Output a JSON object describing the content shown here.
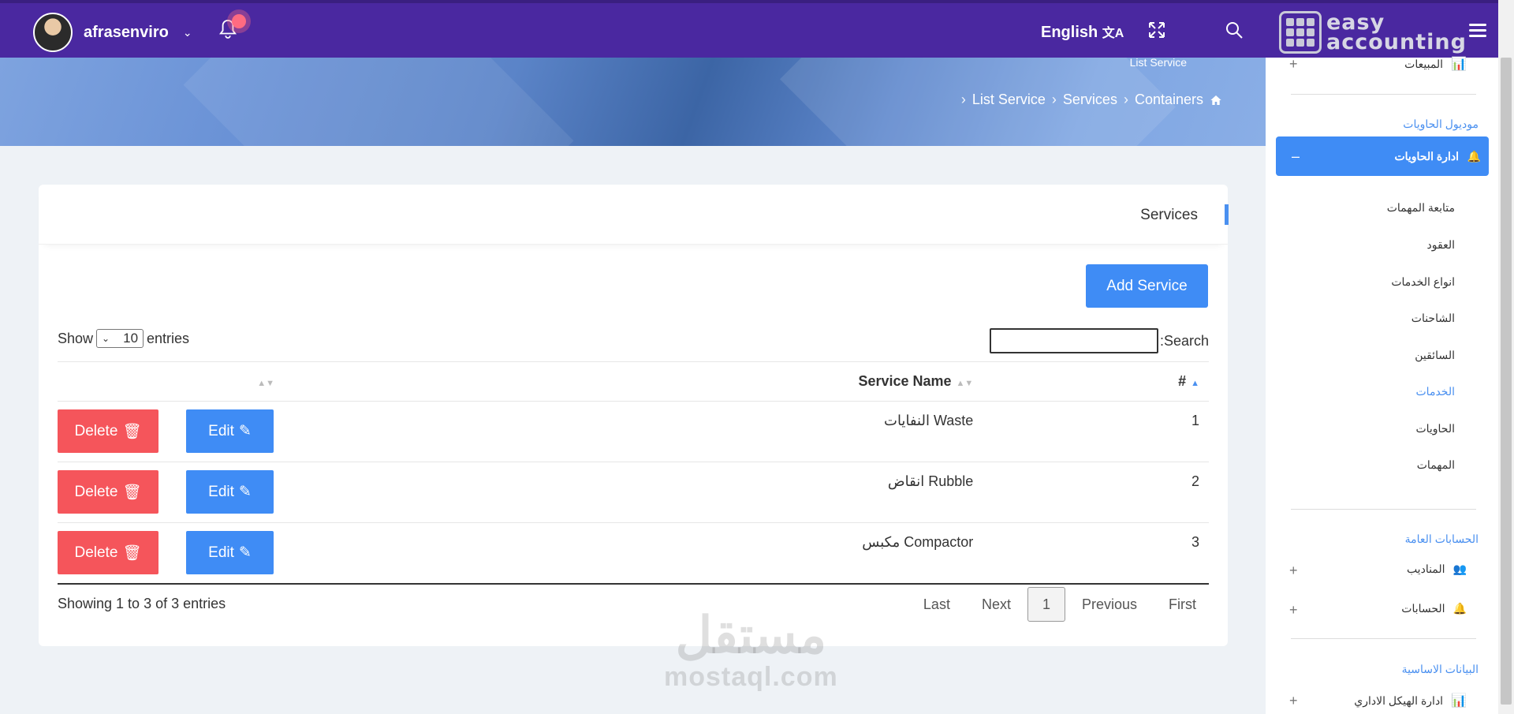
{
  "topbar": {
    "username": "afrasenviro",
    "language": "English",
    "logo_line1": "easy",
    "logo_line2": "accounting"
  },
  "banner": {
    "title": "List Service",
    "breadcrumb": [
      "List Service",
      "Services",
      "Containers"
    ]
  },
  "card": {
    "title": "Services",
    "add_button": "Add Service",
    "show_label": "Show",
    "entries_value": "10",
    "entries_label": "entries",
    "search_label": ":Search",
    "columns": {
      "num": "#",
      "name": "Service Name",
      "actions": ""
    },
    "rows": [
      {
        "num": "1",
        "name": "النفايات Waste",
        "edit": "Edit",
        "delete": "Delete"
      },
      {
        "num": "2",
        "name": "انقاض Rubble",
        "edit": "Edit",
        "delete": "Delete"
      },
      {
        "num": "3",
        "name": "مكبس Compactor",
        "edit": "Edit",
        "delete": "Delete"
      }
    ],
    "info": "Showing 1 to 3 of 3 entries",
    "pager": {
      "last": "Last",
      "next": "Next",
      "current": "1",
      "previous": "Previous",
      "first": "First"
    }
  },
  "watermark": {
    "arabic": "مستقل",
    "latin": "mostaql.com"
  },
  "sidebar": {
    "top_item": "المبيعات",
    "section_containers": "موديول الحاويات",
    "active_item": "ادارة الحاويات",
    "sub_items": [
      "متابعة المهمات",
      "العقود",
      "انواع الخدمات",
      "الشاحنات",
      "السائقين",
      "الخدمات",
      "الحاويات",
      "المهمات"
    ],
    "current_sub": "الخدمات",
    "section_accounts": "الحسابات العامة",
    "accounts_items": [
      "المناديب",
      "الحسابات"
    ],
    "section_basic": "البيانات الاساسية",
    "basic_items": [
      "ادارة الهيكل الاداري"
    ]
  },
  "colors": {
    "topbar": "#4a28a0",
    "primary": "#3f8cf5",
    "danger": "#f5555b",
    "accent": "#4a90f0"
  },
  "icons": [
    "bell-icon",
    "language-icon",
    "expand-icon",
    "search-icon",
    "menu-icon",
    "home-icon",
    "trash-icon",
    "pencil-icon",
    "chart-icon",
    "users-icon"
  ]
}
